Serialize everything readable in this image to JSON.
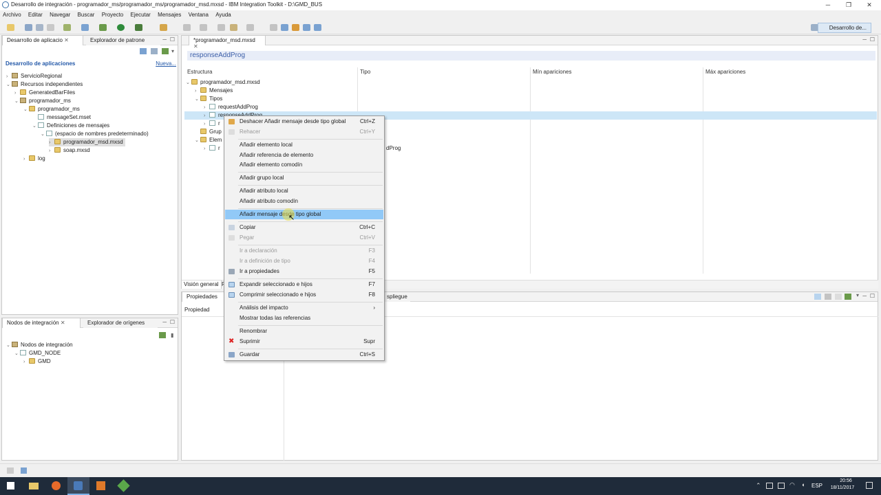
{
  "window": {
    "title": "Desarrollo de integración - programador_ms/programador_ms/programador_msd.mxsd - IBM Integration Toolkit - D:\\GMD_BUS"
  },
  "menubar": [
    "Archivo",
    "Editar",
    "Navegar",
    "Buscar",
    "Proyecto",
    "Ejecutar",
    "Mensajes",
    "Ventana",
    "Ayuda"
  ],
  "perspective": "Desarrollo de...",
  "left_panel": {
    "tabs": [
      "Desarrollo de aplicacio",
      "Explorador de patrone"
    ],
    "header": "Desarrollo de aplicaciones",
    "new_link": "Nueva...",
    "tree": [
      "ServicioRegional",
      "Recursos independientes",
      "GeneratedBarFiles",
      "programador_ms",
      "programador_ms",
      "messageSet.mset",
      "Definiciones de mensajes",
      "(espacio de nombres predeterminado)",
      "programador_msd.mxsd",
      "soap.mxsd",
      "log"
    ]
  },
  "bottom_left_panel": {
    "tabs": [
      "Nodos de integración",
      "Explorador de orígenes"
    ],
    "tree": [
      "Nodos de integración",
      "GMD_NODE",
      "GMD"
    ]
  },
  "editor": {
    "tab": "*programador_msd.mxsd",
    "heading": "responseAddProg",
    "columns": [
      "Estructura",
      "Tipo",
      "Mín apariciones",
      "Máx apariciones"
    ],
    "tree": [
      "programador_msd.mxsd",
      "Mensajes",
      "Tipos",
      "requestAddProg",
      "responseAddProg",
      "r",
      "Grup",
      "Elem",
      "r"
    ],
    "type_cell": "dProg",
    "bottom_tabs": [
      "Visión general",
      "F"
    ]
  },
  "properties_panel": {
    "tab": "Propiedades",
    "tab2": "spliegue",
    "column": "Propiedad"
  },
  "context_menu": {
    "items": [
      {
        "label": "Deshacer Añadir mensaje desde tipo global",
        "shortcut": "Ctrl+Z",
        "disabled": false
      },
      {
        "label": "Rehacer",
        "shortcut": "Ctrl+Y",
        "disabled": true
      },
      {
        "label": "Añadir elemento local",
        "shortcut": "",
        "disabled": false
      },
      {
        "label": "Añadir referencia de elemento",
        "shortcut": "",
        "disabled": false
      },
      {
        "label": "Añadir elemento comodín",
        "shortcut": "",
        "disabled": false
      },
      {
        "label": "Añadir grupo local",
        "shortcut": "",
        "disabled": false
      },
      {
        "label": "Añadir atributo local",
        "shortcut": "",
        "disabled": false
      },
      {
        "label": "Añadir atributo comodín",
        "shortcut": "",
        "disabled": false
      },
      {
        "label": "Añadir mensaje desde tipo global",
        "shortcut": "",
        "disabled": false,
        "highlighted": true
      },
      {
        "label": "Copiar",
        "shortcut": "Ctrl+C",
        "disabled": false
      },
      {
        "label": "Pegar",
        "shortcut": "Ctrl+V",
        "disabled": true
      },
      {
        "label": "Ir a declaración",
        "shortcut": "F3",
        "disabled": true
      },
      {
        "label": "Ir a definición de tipo",
        "shortcut": "F4",
        "disabled": true
      },
      {
        "label": "Ir a propiedades",
        "shortcut": "F5",
        "disabled": false
      },
      {
        "label": "Expandir seleccionado e hijos",
        "shortcut": "F7",
        "disabled": false
      },
      {
        "label": "Comprimir seleccionado e hijos",
        "shortcut": "F8",
        "disabled": false
      },
      {
        "label": "Análisis del impacto",
        "shortcut": "›",
        "disabled": false
      },
      {
        "label": "Mostrar todas las referencias",
        "shortcut": "",
        "disabled": false
      },
      {
        "label": "Renombrar",
        "shortcut": "",
        "disabled": false
      },
      {
        "label": "Suprimir",
        "shortcut": "Supr",
        "disabled": false
      },
      {
        "label": "Guardar",
        "shortcut": "Ctrl+S",
        "disabled": false
      }
    ]
  },
  "taskbar": {
    "lang": "ESP",
    "time": "20:56",
    "date": "18/11/2017"
  }
}
